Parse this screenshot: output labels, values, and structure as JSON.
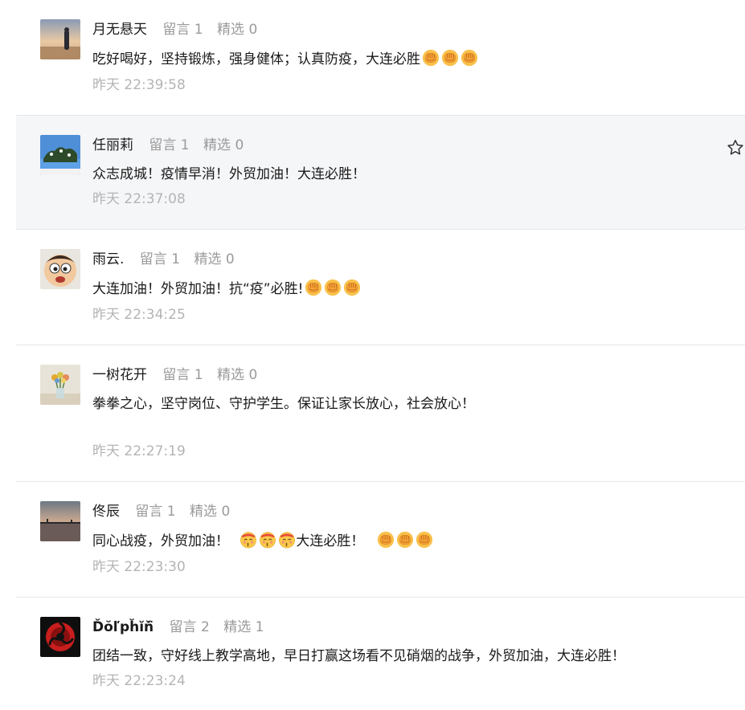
{
  "labels": {
    "reply_prefix": "留言",
    "featured_prefix": "精选"
  },
  "comments": [
    {
      "nickname": "月无悬天",
      "reply_count": "留言 1",
      "featured_count": "精选 0",
      "content": "吃好喝好，坚持锻炼，强身健体；认真防疫，大连必胜",
      "emojis": [
        "fist-emoji",
        "fist-emoji",
        "fist-emoji"
      ],
      "time": "昨天 22:39:58"
    },
    {
      "nickname": "任丽莉",
      "reply_count": "留言 1",
      "featured_count": "精选 0",
      "content": "众志成城！疫情早消！外贸加油！大连必胜！",
      "emojis": [],
      "time": "昨天 22:37:08",
      "highlighted": true,
      "star_icon": "star-outline-icon"
    },
    {
      "nickname": "雨云.",
      "reply_count": "留言 1",
      "featured_count": "精选 0",
      "content": "大连加油！外贸加油！抗“疫”必胜!",
      "emojis": [
        "fist-emoji",
        "fist-emoji",
        "fist-emoji"
      ],
      "time": "昨天 22:34:25"
    },
    {
      "nickname": "一树花开",
      "reply_count": "留言 1",
      "featured_count": "精选 0",
      "content": "拳拳之心，坚守岗位、守护学生。保证让家长放心，社会放心！",
      "emojis": [],
      "time": "昨天 22:27:19"
    },
    {
      "nickname": "佟辰",
      "reply_count": "留言 1",
      "featured_count": "精选 0",
      "content_part1": "同心战疫，外贸加油！",
      "content_part2": "大连必胜！",
      "time": "昨天 22:23:30"
    },
    {
      "nickname": "Ďŏľpȟĭň̈",
      "reply_count": "留言 2",
      "featured_count": "精选 1",
      "content": "团结一致，守好线上教学高地，早日打赢这场看不见硝烟的战争，外贸加油，大连必胜！",
      "emojis": [],
      "time": "昨天 22:23:24"
    }
  ],
  "colors": {
    "text_primary": "#1a1a1a",
    "text_meta": "#9a9a9a",
    "text_time": "#b4b4b4",
    "highlight_bg": "#f5f6f8",
    "divider": "#e7e7e7",
    "emoji_yellow": "#f7b93a"
  }
}
